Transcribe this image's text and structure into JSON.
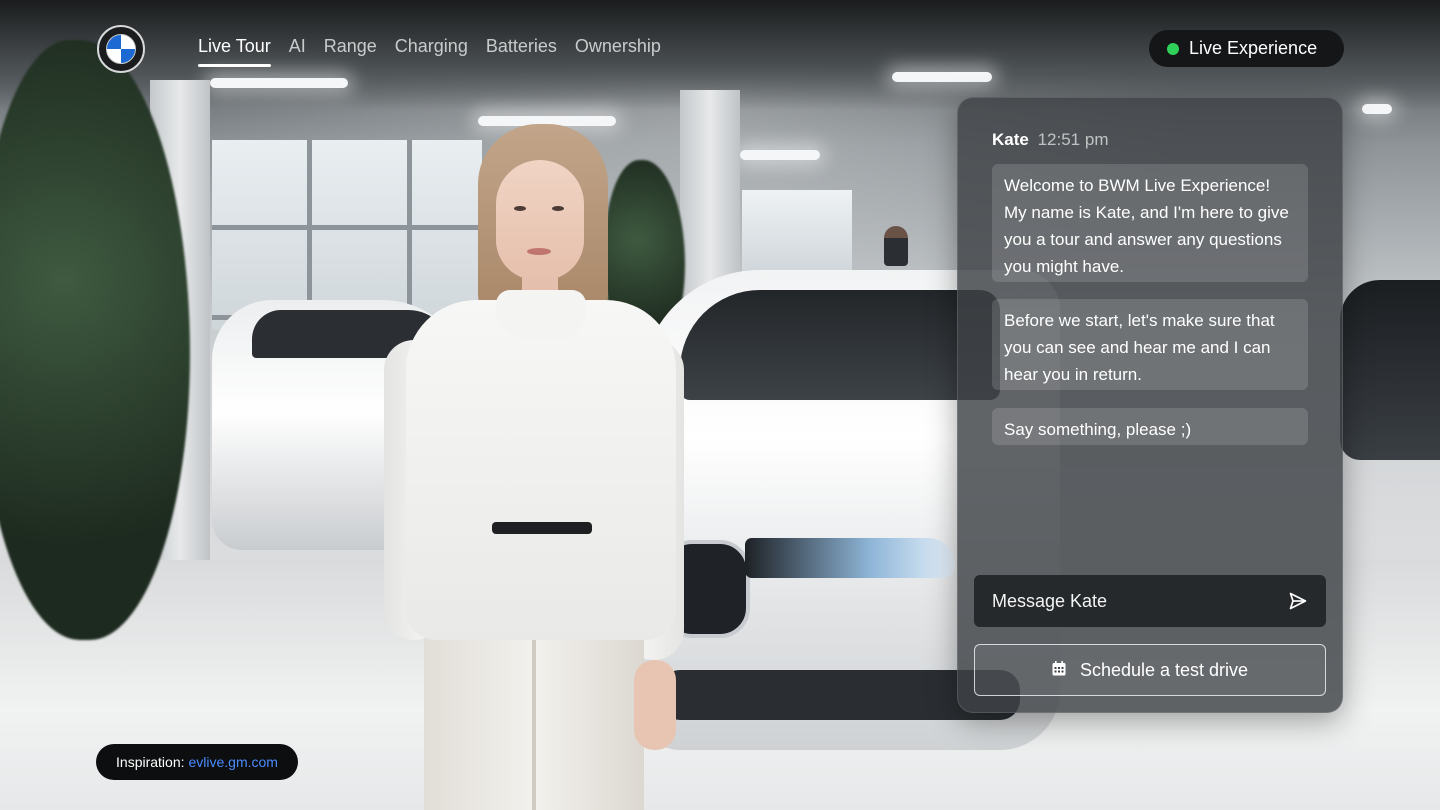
{
  "brand": {
    "logo_icon": "bmw-roundel-icon",
    "accent": "#1c69d4"
  },
  "nav": {
    "items": [
      {
        "label": "Live Tour",
        "active": true
      },
      {
        "label": "AI",
        "active": false
      },
      {
        "label": "Range",
        "active": false
      },
      {
        "label": "Charging",
        "active": false
      },
      {
        "label": "Batteries",
        "active": false
      },
      {
        "label": "Ownership",
        "active": false
      }
    ]
  },
  "live_badge": {
    "label": "Live Experience",
    "status_color": "#2fd15a"
  },
  "chat": {
    "agent_name": "Kate",
    "time": "12:51 pm",
    "messages": [
      "Welcome to BWM Live Experience! My name is Kate, and I'm here to give you a tour and answer any questions you might have.",
      "Before we start, let's make sure that you can see and hear me and I can hear you in return.",
      "Say something, please ;)"
    ],
    "input_placeholder": "Message Kate",
    "send_icon": "send-icon",
    "schedule_label": "Schedule a test drive",
    "schedule_icon": "calendar-icon"
  },
  "inspiration": {
    "label": "Inspiration:",
    "link": "evlive.gm.com",
    "link_color": "#4a8cff"
  }
}
